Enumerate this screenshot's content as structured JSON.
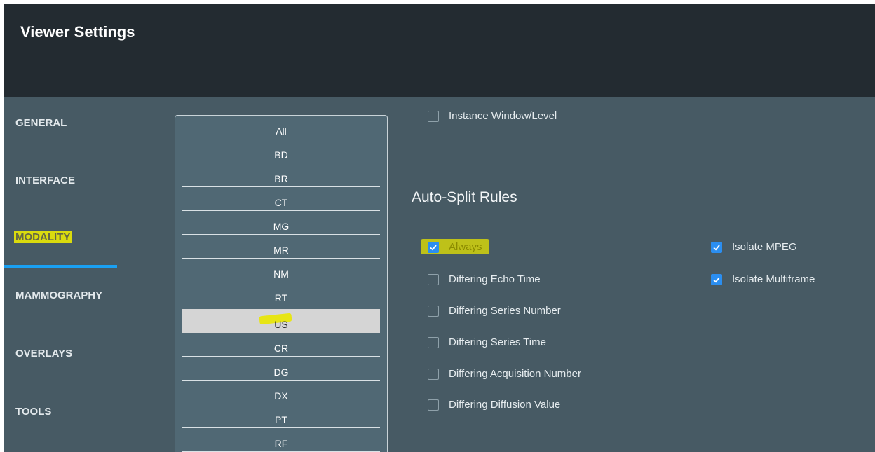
{
  "header": {
    "title": "Viewer Settings"
  },
  "sidebar": {
    "items": [
      {
        "label": "GENERAL"
      },
      {
        "label": "INTERFACE"
      },
      {
        "label": "MODALITY"
      },
      {
        "label": "MAMMOGRAPHY"
      },
      {
        "label": "OVERLAYS"
      },
      {
        "label": "TOOLS"
      }
    ],
    "active": "MODALITY"
  },
  "modalities": {
    "items": [
      "All",
      "BD",
      "BR",
      "CT",
      "MG",
      "MR",
      "NM",
      "RT",
      "US",
      "CR",
      "DG",
      "DX",
      "PT",
      "RF"
    ],
    "selected": "US"
  },
  "options": {
    "instance_window_level": {
      "label": "Instance Window/Level",
      "checked": false
    }
  },
  "auto_split": {
    "title": "Auto-Split Rules",
    "rules": [
      {
        "label": "Always",
        "checked": true
      },
      {
        "label": "Differing Echo Time",
        "checked": false
      },
      {
        "label": "Differing Series Number",
        "checked": false
      },
      {
        "label": "Differing Series Time",
        "checked": false
      },
      {
        "label": "Differing Acquisition Number",
        "checked": false
      },
      {
        "label": "Differing Diffusion Value",
        "checked": false
      }
    ],
    "isolate": [
      {
        "label": "Isolate MPEG",
        "checked": true
      },
      {
        "label": "Isolate Multiframe",
        "checked": true
      }
    ]
  },
  "colors": {
    "header_bg": "#232b31",
    "panel_bg": "#475a64",
    "accent": "#1aa0f2",
    "checkbox_checked": "#2b8ef0",
    "highlighter": "#f4f200"
  }
}
